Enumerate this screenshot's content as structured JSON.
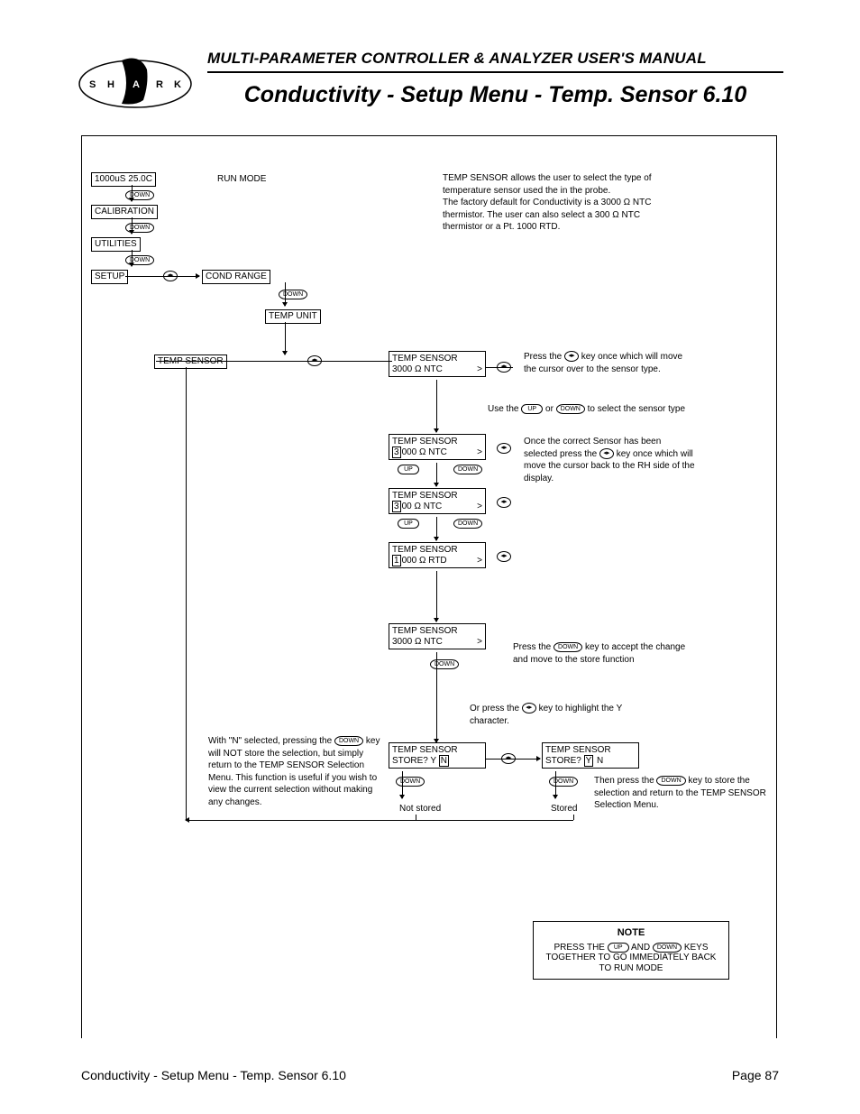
{
  "header": {
    "manual_title": "MULTI-PARAMETER CONTROLLER & ANALYZER USER'S MANUAL",
    "page_title": "Conductivity - Setup Menu - Temp. Sensor 6.10",
    "logo_letters": [
      "S",
      "H",
      "A",
      "R",
      "K"
    ]
  },
  "footer": {
    "left": "Conductivity - Setup Menu - Temp. Sensor 6.10",
    "right": "Page 87"
  },
  "intro": {
    "p1": "TEMP SENSOR allows the user to select the type of temperature sensor used the in the probe.",
    "p2": "The factory default for Conductivity is a 3000 Ω NTC thermistor. The user can also select a 300 Ω NTC thermistor or a Pt. 1000 RTD."
  },
  "menu": {
    "run_display": "1000uS  25.0C",
    "run_mode": "RUN MODE",
    "calibration": "CALIBRATION",
    "utilities": "UTILITIES",
    "setup": "SETUP",
    "cond_range": "COND RANGE",
    "temp_unit": "TEMP UNIT",
    "temp_sensor_label": "TEMP SENSOR"
  },
  "screens": {
    "sensor1_l1": "TEMP SENSOR",
    "sensor1_l2": "3000 Ω NTC",
    "sensor2_l1": "TEMP SENSOR",
    "sensor2_l2_pre": "3",
    "sensor2_l2_post": "000 Ω NTC",
    "sensor3_l1": "TEMP SENSOR",
    "sensor3_l2_pre": "3",
    "sensor3_l2_post": "00 Ω NTC",
    "sensor4_l1": "TEMP SENSOR",
    "sensor4_l2_pre": "1",
    "sensor4_l2_post": "000 Ω  RTD",
    "sensor5_l1": "TEMP SENSOR",
    "sensor5_l2": "3000 Ω NTC",
    "storeN_l1": "TEMP SENSOR",
    "storeN_l2": "STORE?            Y",
    "storeN_hi": "N",
    "storeY_l1": "TEMP SENSOR",
    "storeY_l2_pre": "STORE?           ",
    "storeY_hi": "Y",
    "storeY_l2_post": " N",
    "not_stored": "Not stored",
    "stored": "Stored"
  },
  "instructions": {
    "press_move_cursor_1": "Press the ",
    "press_move_cursor_2": " key once which will move the cursor over to the sensor type.",
    "use_updown_1": "Use the ",
    "use_updown_2": " or ",
    "use_updown_3": " to select the sensor type",
    "once_selected_1": "Once the correct Sensor has been selected press the ",
    "once_selected_2": " key once which will move the cursor back to the RH side of the display.",
    "press_down_store_1": "Press the ",
    "press_down_store_2": " key to accept the change and move to the store function",
    "or_press_y_1": "Or press the ",
    "or_press_y_2": " key to highlight the Y character.",
    "then_store_1": "Then press the ",
    "then_store_2": " key to store the selection and return to the TEMP SENSOR Selection Menu.",
    "n_explain_1": "With \"N\" selected, pressing the ",
    "n_explain_2": " key will NOT store the selection, but simply return to the TEMP SENSOR Selection Menu. This function is useful if you wish to view the current selection without making any changes."
  },
  "note": {
    "title": "NOTE",
    "text_1": "PRESS THE ",
    "text_mid": " AND ",
    "text_2": " KEYS TOGETHER TO GO IMMEDIATELY BACK TO RUN MODE"
  },
  "keys": {
    "up": "UP",
    "down": "DOWN",
    "enter": "◂▸"
  }
}
